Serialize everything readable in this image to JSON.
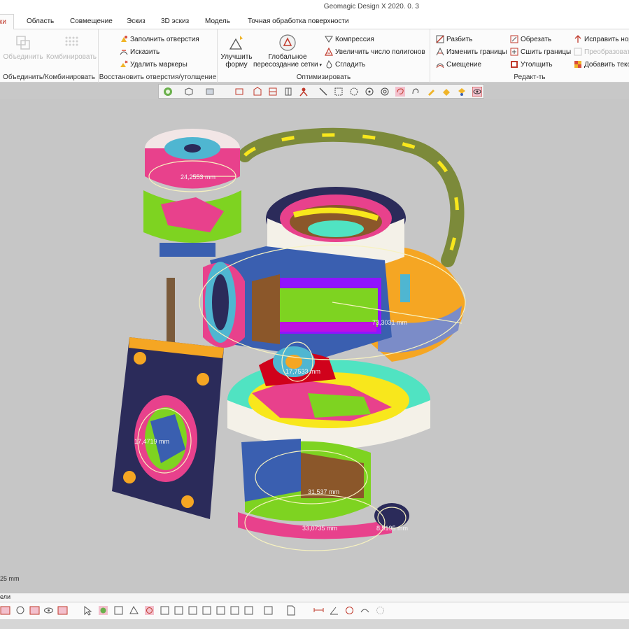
{
  "window": {
    "title": "Geomagic Design X 2020. 0. 3"
  },
  "tabs": [
    {
      "label": "ки",
      "active": true
    },
    {
      "label": "Область"
    },
    {
      "label": "Совмещение"
    },
    {
      "label": "Эскиз"
    },
    {
      "label": "3D эскиз"
    },
    {
      "label": "Модель"
    },
    {
      "label": "Точная обработка поверхности"
    }
  ],
  "ribbon": {
    "merge_group": {
      "label": "Объединить/Комбинировать",
      "merge_button": "Объединить",
      "combine_button": "Комбинировать"
    },
    "repair_group": {
      "label": "Восстановить отверстия/утолщение",
      "fill_holes": "Заполнить отверстия",
      "distort": "Исказить",
      "remove_markers": "Удалить маркеры"
    },
    "optimize_group": {
      "label": "Оптимизировать",
      "improve_shape_line1": "Улучшить",
      "improve_shape_line2": "форму",
      "global_remesh_line1": "Глобальное",
      "global_remesh_line2": "пересоздание сетки",
      "compress": "Компрессия",
      "increase_polygons": "Увеличить число полигонов",
      "smooth": "Сгладить"
    },
    "edit_group": {
      "label": "Редакт-ть",
      "split": "Разбить",
      "trim": "Обрезать",
      "fix_normals": "Исправить нормали",
      "edit_boundaries": "Изменить границы",
      "stitch_boundaries": "Сшить границы",
      "convert": "Преобразовать",
      "offset": "Смещение",
      "thicken": "Утолщить",
      "add_texture": "Добавить текстуру"
    }
  },
  "viewport": {
    "measurements": [
      "24,2553 mm",
      "73,3031 mm",
      "17,7533 mm",
      "17,4719 mm",
      "31,537 mm",
      "33,0735 mm",
      "8,9195 mm"
    ],
    "scale_label": "25 mm"
  },
  "bottom_panel": {
    "tab_label": "ели"
  },
  "colors": {
    "accent": "#c0392b",
    "viewport_bg": "#c6c6c6",
    "ribbon_bg": "#fbfbfb",
    "mesh_palette": [
      "#e8418c",
      "#7ed321",
      "#3a5fb0",
      "#f5a623",
      "#2b2b5a",
      "#f8e71c",
      "#50e3c2",
      "#9013fe",
      "#bd10e0",
      "#d0021b",
      "#8b572a",
      "#ffffff"
    ]
  },
  "icons": [
    "merge-icon",
    "combine-icon",
    "fill-holes-icon",
    "distort-icon",
    "remove-markers-icon",
    "improve-shape-icon",
    "global-remesh-icon",
    "compress-icon",
    "increase-polygons-icon",
    "smooth-icon",
    "split-icon",
    "trim-icon",
    "fix-normals-icon",
    "edit-boundaries-icon",
    "stitch-icon",
    "convert-icon",
    "offset-icon",
    "thicken-icon",
    "texture-icon"
  ]
}
